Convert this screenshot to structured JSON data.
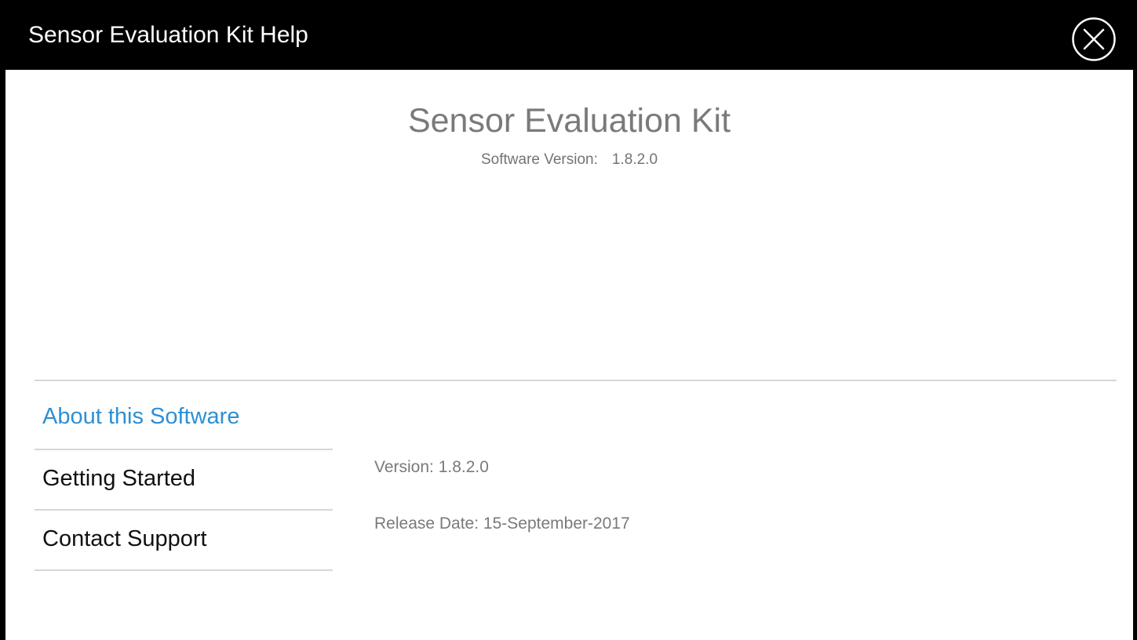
{
  "window": {
    "title": "Sensor Evaluation Kit Help",
    "close_icon": "close-circle-x-icon"
  },
  "header": {
    "product_name": "Sensor Evaluation Kit",
    "version_label": "Software Version:",
    "version_value": "1.8.2.0"
  },
  "nav": {
    "items": [
      {
        "label": "About this Software",
        "active": true
      },
      {
        "label": "Getting Started",
        "active": false
      },
      {
        "label": "Contact Support",
        "active": false
      }
    ]
  },
  "details": {
    "version": "Version: 1.8.2.0",
    "release_date": "Release Date: 15-September-2017"
  },
  "colors": {
    "titlebar_bg": "#000000",
    "accent": "#2e8fd3",
    "muted_text": "#7a7a7a",
    "divider": "#d7d7d7"
  }
}
